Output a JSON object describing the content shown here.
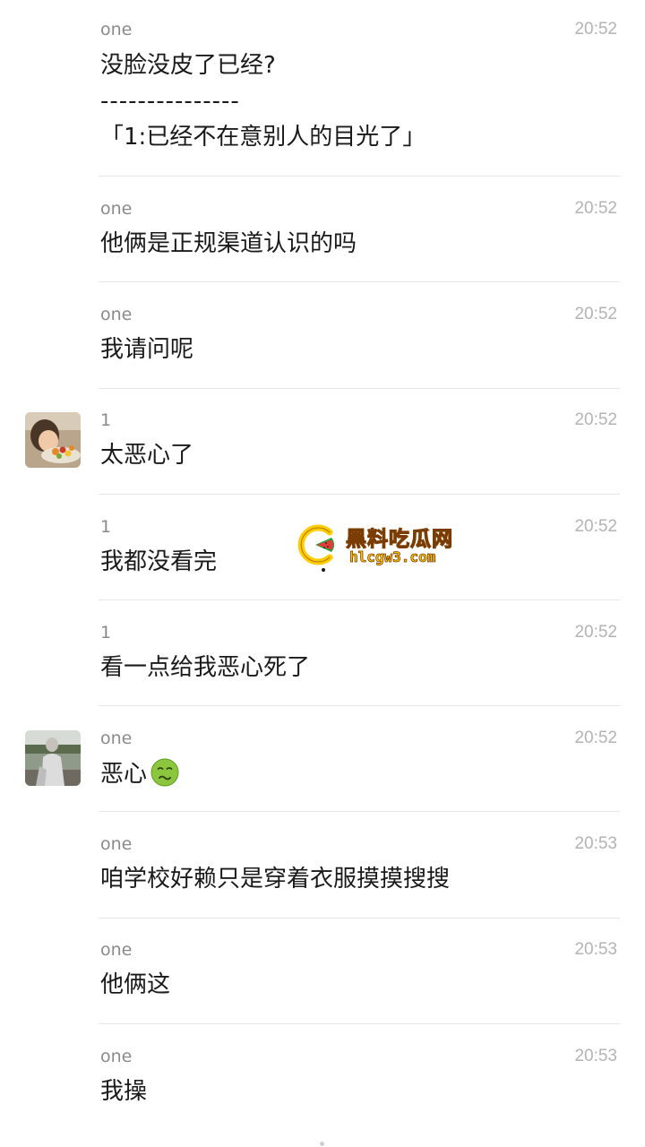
{
  "messages": [
    {
      "sender": "one",
      "time": "20:52",
      "lines": [
        "没脸没皮了已经?",
        "---------------",
        "「1:已经不在意别人的目光了」"
      ],
      "avatar": null
    },
    {
      "sender": "one",
      "time": "20:52",
      "lines": [
        "他俩是正规渠道认识的吗"
      ],
      "avatar": null
    },
    {
      "sender": "one",
      "time": "20:52",
      "lines": [
        "我请问呢"
      ],
      "avatar": null
    },
    {
      "sender": "1",
      "time": "20:52",
      "lines": [
        "太恶心了"
      ],
      "avatar": "child-eating-photo"
    },
    {
      "sender": "1",
      "time": "20:52",
      "lines": [
        "我都没看完"
      ],
      "avatar": null
    },
    {
      "sender": "1",
      "time": "20:52",
      "lines": [
        "看一点给我恶心死了"
      ],
      "avatar": null
    },
    {
      "sender": "one",
      "time": "20:52",
      "lines": [
        "恶心"
      ],
      "emoji": "nauseated-face-icon",
      "avatar": "person-outdoor-photo"
    },
    {
      "sender": "one",
      "time": "20:53",
      "lines": [
        "咱学校好赖只是穿着衣服摸摸搜搜"
      ],
      "avatar": null
    },
    {
      "sender": "one",
      "time": "20:53",
      "lines": [
        "他俩这"
      ],
      "avatar": null
    },
    {
      "sender": "one",
      "time": "20:53",
      "lines": [
        "我操"
      ],
      "avatar": null
    }
  ],
  "watermark": {
    "title": "黑料吃瓜网",
    "url": "hlcgw3.com"
  },
  "colors": {
    "sender": "#8a8a8a",
    "time": "#b3b3b3",
    "text": "#1a1a1a",
    "divider": "#e6e6e6",
    "watermark": "#ffcc00"
  }
}
